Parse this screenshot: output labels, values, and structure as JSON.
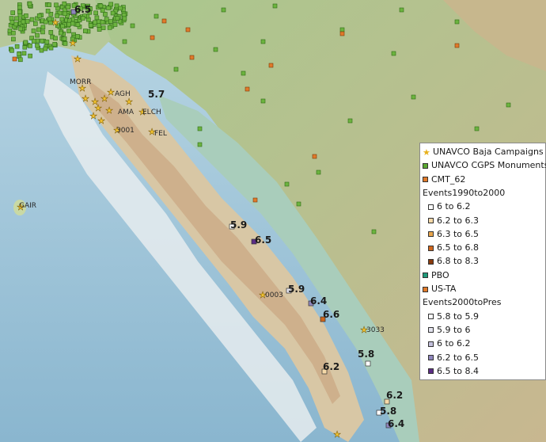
{
  "map": {
    "magnitudes": [
      {
        "label": "6.5"
      },
      {
        "label": "5.7"
      },
      {
        "label": "5.9"
      },
      {
        "label": "6.5"
      },
      {
        "label": "5.9"
      },
      {
        "label": "6.4"
      },
      {
        "label": "6.6"
      },
      {
        "label": "5.8"
      },
      {
        "label": "6.2"
      },
      {
        "label": "6.2"
      },
      {
        "label": "5.8"
      },
      {
        "label": "6.4"
      }
    ],
    "sites": [
      {
        "label": "MORR"
      },
      {
        "label": "AGH"
      },
      {
        "label": "AMA"
      },
      {
        "label": "ELCH"
      },
      {
        "label": "FEL"
      },
      {
        "label": "3001"
      },
      {
        "label": "GAIR"
      },
      {
        "label": "0003"
      },
      {
        "label": "3033"
      }
    ]
  },
  "legend": {
    "items": [
      {
        "label": "UNAVCO Baja Campaigns",
        "color": "#e8b11c",
        "kind": "star"
      },
      {
        "label": "UNAVCO CGPS Monuments",
        "color": "#5aa832",
        "kind": "square"
      },
      {
        "label": "CMT_62",
        "color": "#e07a2a",
        "kind": "square"
      },
      {
        "label": "Events1990to2000",
        "kind": "header"
      },
      {
        "label": "6 to 6.2",
        "color": "#ffffff",
        "kind": "sub"
      },
      {
        "label": "6.2 to 6.3",
        "color": "#f6d9a8",
        "kind": "sub"
      },
      {
        "label": "6.3 to 6.5",
        "color": "#e9a64c",
        "kind": "sub"
      },
      {
        "label": "6.5 to 6.8",
        "color": "#d0661c",
        "kind": "sub"
      },
      {
        "label": "6.8 to 8.3",
        "color": "#8a3b0d",
        "kind": "sub"
      },
      {
        "label": "PBO",
        "color": "#1f9a7a",
        "kind": "square"
      },
      {
        "label": "US-TA",
        "color": "#e07a2a",
        "kind": "square"
      },
      {
        "label": "Events2000toPres",
        "kind": "header"
      },
      {
        "label": "5.8 to 5.9",
        "color": "#ffffff",
        "kind": "sub"
      },
      {
        "label": "5.9 to 6",
        "color": "#e4e4ef",
        "kind": "sub"
      },
      {
        "label": "6 to 6.2",
        "color": "#c3c0dc",
        "kind": "sub"
      },
      {
        "label": "6.2 to 6.5",
        "color": "#8f86bd",
        "kind": "sub"
      },
      {
        "label": "6.5 to 8.4",
        "color": "#5b2c86",
        "kind": "sub"
      }
    ]
  }
}
